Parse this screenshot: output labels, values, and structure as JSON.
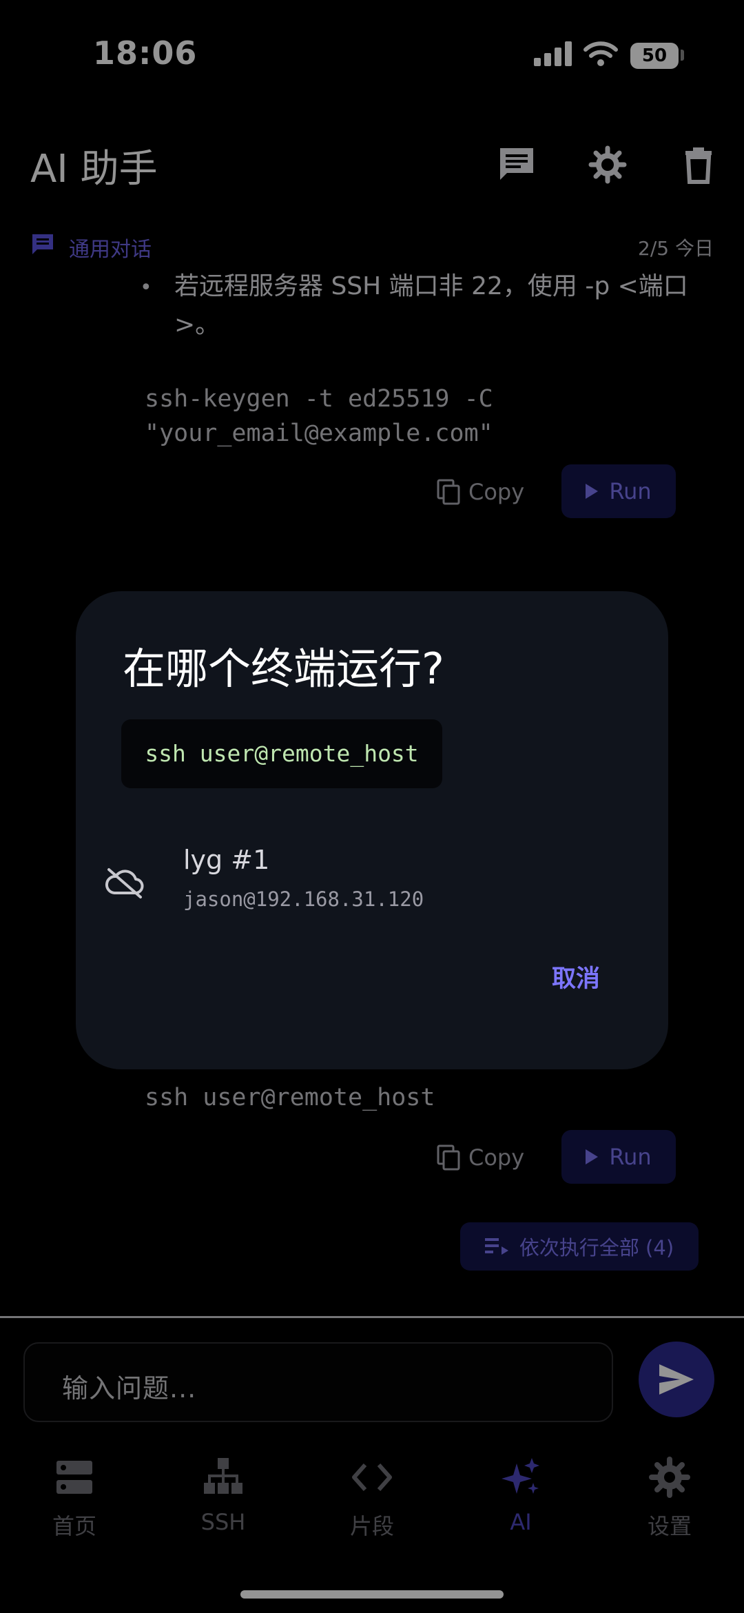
{
  "status_bar": {
    "time": "18:06",
    "battery": "50"
  },
  "header": {
    "title": "AI 助手"
  },
  "subheader": {
    "label": "通用对话",
    "meta": "2/5 今日"
  },
  "messages": {
    "bullet_text": "若远程服务器 SSH 端口非 22，使用 -p <端口>。",
    "code_block_1": "ssh-keygen -t ed25519 -C\n\"your_email@example.com\"",
    "code_block_2": "ssh user@remote_host",
    "copy_label": "Copy",
    "run_label": "Run",
    "run_all_label": "依次执行全部 (4)"
  },
  "dialog": {
    "title": "在哪个终端运行?",
    "command": "ssh user@remote_host",
    "terminal": {
      "name": "lyg #1",
      "host": "jason@192.168.31.120"
    },
    "cancel_label": "取消"
  },
  "input": {
    "placeholder": "输入问题..."
  },
  "nav": {
    "items": [
      {
        "label": "首页",
        "icon": "server-icon"
      },
      {
        "label": "SSH",
        "icon": "network-icon"
      },
      {
        "label": "片段",
        "icon": "code-icon"
      },
      {
        "label": "AI",
        "icon": "sparkle-icon",
        "active": true
      },
      {
        "label": "设置",
        "icon": "gear-icon"
      }
    ]
  },
  "colors": {
    "accent": "#5b54e0",
    "background": "#000000",
    "dialog": "#10141c",
    "run_button_bg": "#14164a"
  }
}
